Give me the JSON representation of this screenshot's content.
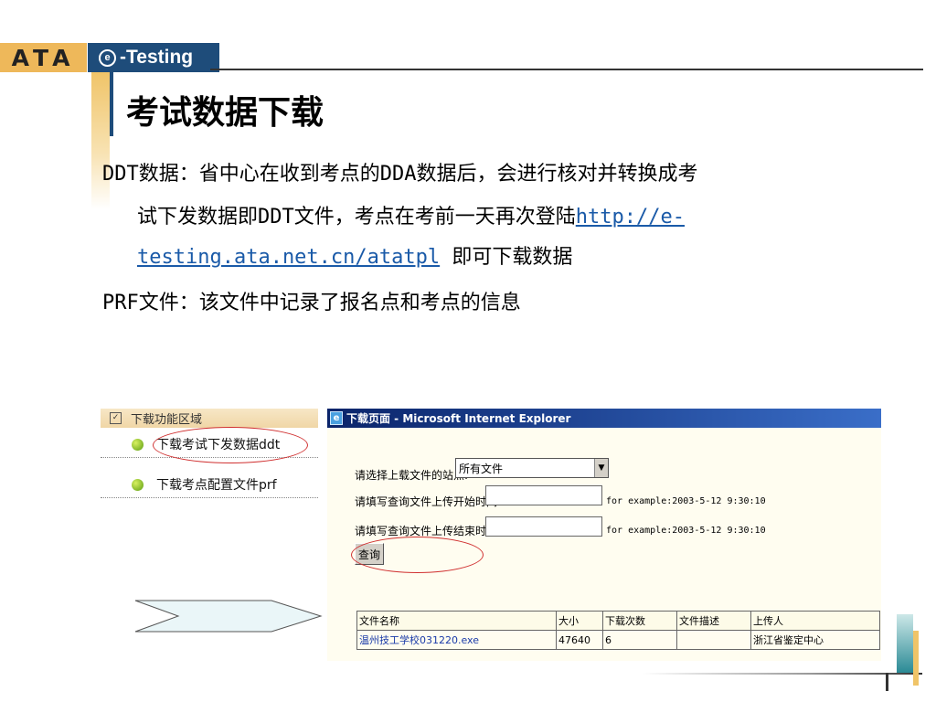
{
  "logo": {
    "ata": "ATA",
    "brand": "-Testing",
    "brand_mark": "e"
  },
  "title": "考试数据下载",
  "body": {
    "line1": "DDT数据：省中心在收到考点的DDA数据后，会进行核对并转换成考",
    "line2_text": "试下发数据即DDT文件，考点在考前一天再次登陆",
    "line2_link": "http://e-",
    "line3_link": "testing.ata.net.cn/atatpl",
    "line3_text": " 即可下载数据",
    "line4": "PRF文件：该文件中记录了报名点和考点的信息"
  },
  "sidebar": {
    "header": "下载功能区域",
    "items": [
      {
        "label": "下载考试下发数据ddt"
      },
      {
        "label": "下载考点配置文件prf"
      }
    ]
  },
  "ie": {
    "title": "下载页面 - Microsoft Internet Explorer",
    "site_label": "请选择上载文件的站点:",
    "site_value": "所有文件",
    "start_label": "请填写查询文件上传开始时间:",
    "start_hint": "for example:2003-5-12 9:30:10",
    "end_label": "请填写查询文件上传结束时间:",
    "end_hint": "for example:2003-5-12 9:30:10",
    "query_button": "查询",
    "table": {
      "headers": [
        "文件名称",
        "大小",
        "下载次数",
        "文件描述",
        "上传人"
      ],
      "rows": [
        [
          "温州技工学校031220.exe",
          "47640",
          "6",
          "",
          "浙江省鉴定中心"
        ]
      ]
    }
  }
}
